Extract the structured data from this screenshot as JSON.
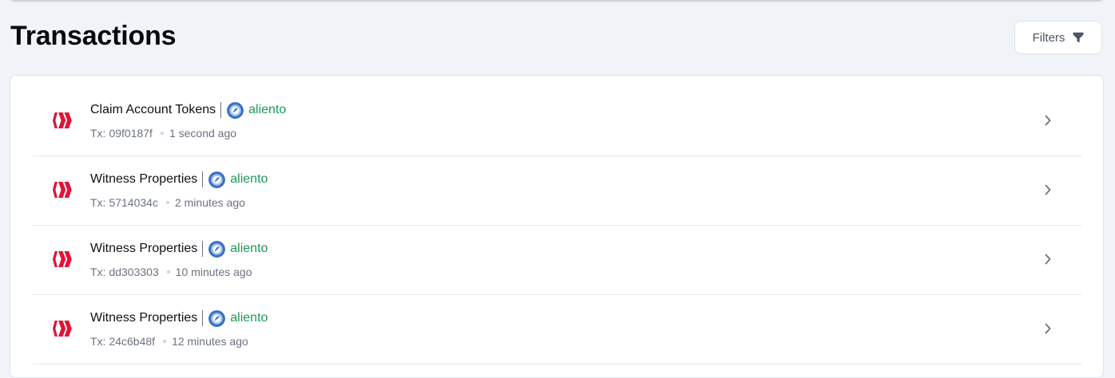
{
  "header": {
    "title": "Transactions",
    "filters_label": "Filters"
  },
  "colors": {
    "background": "#f0f3f8",
    "card": "#ffffff",
    "hive_red": "#e31337",
    "account_green": "#1a9b55",
    "muted_text": "#6b7280"
  },
  "icons": {
    "filters": "funnel-icon",
    "operation": "hive-logo-icon",
    "account": "avatar",
    "row_action": "chevron-right-icon"
  },
  "transactions": [
    {
      "type": "Claim Account Tokens",
      "account": "aliento",
      "tx_prefix": "Tx:",
      "tx_id": "09f0187f",
      "time": "1 second ago"
    },
    {
      "type": "Witness Properties",
      "account": "aliento",
      "tx_prefix": "Tx:",
      "tx_id": "5714034c",
      "time": "2 minutes ago"
    },
    {
      "type": "Witness Properties",
      "account": "aliento",
      "tx_prefix": "Tx:",
      "tx_id": "dd303303",
      "time": "10 minutes ago"
    },
    {
      "type": "Witness Properties",
      "account": "aliento",
      "tx_prefix": "Tx:",
      "tx_id": "24c6b48f",
      "time": "12 minutes ago"
    }
  ]
}
